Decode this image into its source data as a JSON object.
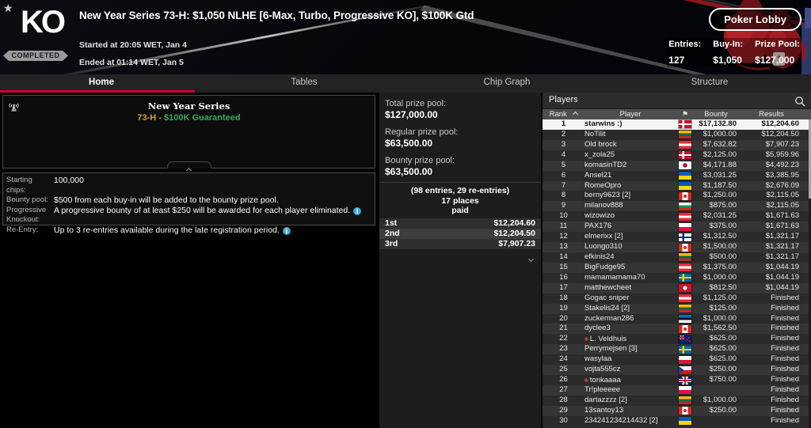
{
  "colors": {
    "accent_red": "#d6002f",
    "series_gold": "#dd9a3e",
    "series_green": "#3faa5c",
    "info_blue": "#3ba7dc",
    "pro_red": "#e03c3c"
  },
  "header": {
    "logo": "KO",
    "status_badge": "COMPLETED",
    "title": "New Year Series 73-H: $1,050 NLHE [6-Max, Turbo, Progressive KO], $100K Gtd",
    "started": "Started at 20:05 WET, Jan 4",
    "ended": "Ended at 01:14 WET, Jan 5",
    "poker_lobby_button": "Poker Lobby",
    "stats": [
      {
        "label": "Entries:",
        "value": "127"
      },
      {
        "label": "Buy-In:",
        "value": "$1,050"
      },
      {
        "label": "Prize Pool:",
        "value": "$127,000"
      }
    ]
  },
  "tabs": [
    {
      "label": "Home",
      "active": true
    },
    {
      "label": "Tables",
      "active": false
    },
    {
      "label": "Chip Graph",
      "active": false
    },
    {
      "label": "Structure",
      "active": false
    }
  ],
  "series_panel": {
    "title": "New Year Series",
    "code": "73-H",
    "separator": " - ",
    "guarantee": "$100K Guaranteed"
  },
  "info_panel": {
    "rows": [
      {
        "label": "Starting chips:",
        "value": "100,000",
        "info": false
      },
      {
        "label": "Bounty pool:",
        "value": "$500 from each buy-in will be added to the bounty prize pool.",
        "info": false
      },
      {
        "label": "Progressive Knockout:",
        "value": "A progressive bounty of at least $250 will be awarded for each player eliminated.",
        "info": true
      },
      {
        "label": "Re-Entry:",
        "value": "Up to 3 re-entries available during the late registration period.",
        "info": true
      }
    ]
  },
  "prize_panel": {
    "total_label": "Total prize pool:",
    "total_value": "$127,000.00",
    "regular_label": "Regular prize pool:",
    "regular_value": "$63,500.00",
    "bounty_label": "Bounty prize pool:",
    "bounty_value": "$63,500.00",
    "entries_line": "(98 entries, 29 re-entries)",
    "places_line1": "17 places",
    "places_line2": "paid",
    "payouts": [
      {
        "place": "1st",
        "amount": "$12,204.60"
      },
      {
        "place": "2nd",
        "amount": "$12,204.50"
      },
      {
        "place": "3rd",
        "amount": "$7,907.23"
      }
    ]
  },
  "players_panel": {
    "title": "Players",
    "columns": {
      "rank": "Rank",
      "player": "Player",
      "bounty": "Bounty",
      "results": "Results"
    },
    "rows": [
      {
        "rank": "1",
        "name": "starwins :)",
        "flag": "dk",
        "bounty": "$17,132.80",
        "result": "$12,204.60",
        "selected": true
      },
      {
        "rank": "2",
        "name": "NoTilit",
        "flag": "lt",
        "bounty": "$1,000.00",
        "result": "$12,204.50"
      },
      {
        "rank": "3",
        "name": "Old brock",
        "flag": "at",
        "bounty": "$7,632.82",
        "result": "$7,907.23"
      },
      {
        "rank": "4",
        "name": "x_zola25",
        "flag": "dk",
        "bounty": "$2,125.00",
        "result": "$5,959.96"
      },
      {
        "rank": "5",
        "name": "komasinTD2",
        "flag": "jp",
        "bounty": "$4,171.88",
        "result": "$4,492.23"
      },
      {
        "rank": "6",
        "name": "Ansel21",
        "flag": "ua",
        "bounty": "$3,031.25",
        "result": "$3,385.95"
      },
      {
        "rank": "7",
        "name": "RomeOpro",
        "flag": "ua",
        "bounty": "$1,187.50",
        "result": "$2,676.09"
      },
      {
        "rank": "8",
        "name": "berny9623 [2]",
        "flag": "ca",
        "bounty": "$1,250.00",
        "result": "$2,115.05"
      },
      {
        "rank": "9",
        "name": "milanov888",
        "flag": "bg",
        "bounty": "$875.00",
        "result": "$2,115.05"
      },
      {
        "rank": "10",
        "name": "wizowizo",
        "flag": "at",
        "bounty": "$2,031.25",
        "result": "$1,671.63"
      },
      {
        "rank": "11",
        "name": "PAX176",
        "flag": "pl",
        "bounty": "$375.00",
        "result": "$1,671.63"
      },
      {
        "rank": "12",
        "name": "elmerixx [2]",
        "flag": "fi",
        "bounty": "$1,312.50",
        "result": "$1,321.17"
      },
      {
        "rank": "13",
        "name": "Luongo310",
        "flag": "ca",
        "bounty": "$1,500.00",
        "result": "$1,321.17"
      },
      {
        "rank": "14",
        "name": "efkinis24",
        "flag": "lt",
        "bounty": "$500.00",
        "result": "$1,321.17"
      },
      {
        "rank": "15",
        "name": "BigFudge95",
        "flag": "at",
        "bounty": "$1,375.00",
        "result": "$1,044.19"
      },
      {
        "rank": "16",
        "name": "mamamamama70",
        "flag": "se",
        "bounty": "$1,000.00",
        "result": "$1,044.19"
      },
      {
        "rank": "17",
        "name": "matthewcheet",
        "flag": "im",
        "bounty": "$812.50",
        "result": "$1,044.19"
      },
      {
        "rank": "18",
        "name": "Gogac sniper",
        "flag": "at",
        "bounty": "$1,125.00",
        "result": "Finished"
      },
      {
        "rank": "19",
        "name": "Stakelis24 [2]",
        "flag": "lt",
        "bounty": "$125.00",
        "result": "Finished"
      },
      {
        "rank": "20",
        "name": "zuckerman286",
        "flag": "ee",
        "bounty": "$1,000.00",
        "result": "Finished"
      },
      {
        "rank": "21",
        "name": "dyclee3",
        "flag": "ca",
        "bounty": "$1,562.50",
        "result": "Finished"
      },
      {
        "rank": "22",
        "name": "L. Veldhuis",
        "flag": "nz",
        "pro": true,
        "bounty": "$625.00",
        "result": "Finished"
      },
      {
        "rank": "23",
        "name": "Perrymejsen [3]",
        "flag": "se",
        "bounty": "$625.00",
        "result": "Finished"
      },
      {
        "rank": "24",
        "name": "wasylaa",
        "flag": "pl",
        "bounty": "$625.00",
        "result": "Finished"
      },
      {
        "rank": "25",
        "name": "vojta555cz",
        "flag": "cz",
        "bounty": "$250.00",
        "result": "Finished"
      },
      {
        "rank": "26",
        "name": "tonkaaaa",
        "flag": "gb",
        "pro": true,
        "bounty": "$750.00",
        "result": "Finished"
      },
      {
        "rank": "27",
        "name": "Tr!pleeeee",
        "flag": "pl",
        "bounty": "",
        "result": "Finished"
      },
      {
        "rank": "28",
        "name": "dartazzzz [2]",
        "flag": "lt",
        "bounty": "$1,000.00",
        "result": "Finished"
      },
      {
        "rank": "29",
        "name": "13santoy13",
        "flag": "ca",
        "bounty": "$250.00",
        "result": "Finished"
      },
      {
        "rank": "30",
        "name": "234241234214432 [2]",
        "flag": "ua",
        "bounty": "",
        "result": "Finished"
      }
    ]
  }
}
